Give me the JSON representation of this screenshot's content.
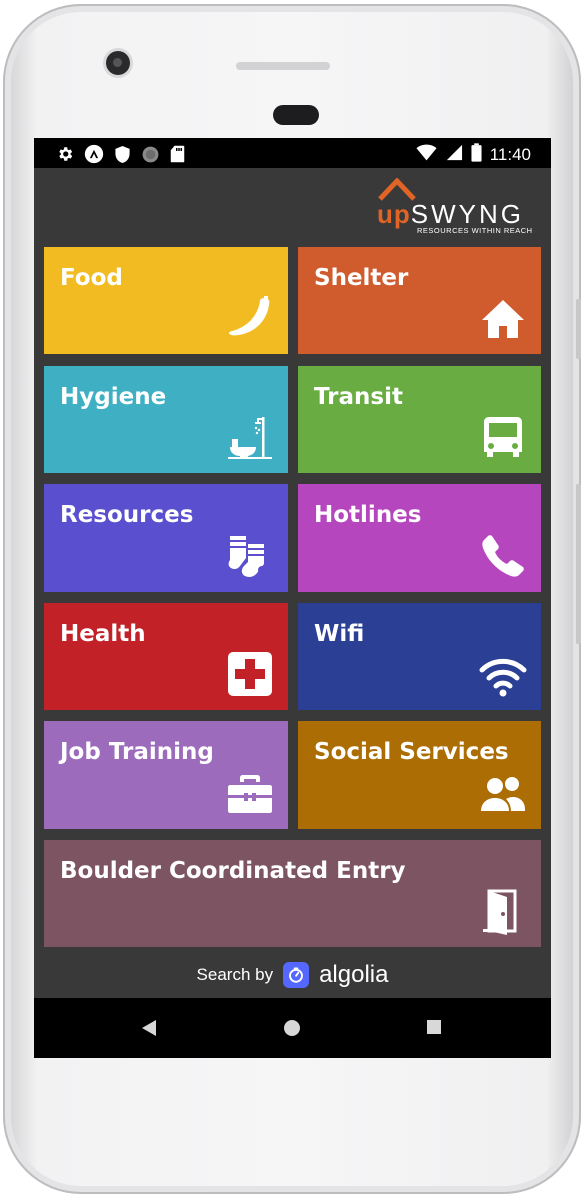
{
  "status_bar": {
    "time": "11:40"
  },
  "brand": {
    "up": "up",
    "rest": "SWYNG",
    "tagline": "RESOURCES WITHIN REACH",
    "accent": "#e06425"
  },
  "tiles": [
    {
      "id": "food",
      "label": "Food",
      "color": "#f2bb22",
      "icon": "banana-icon"
    },
    {
      "id": "shelter",
      "label": "Shelter",
      "color": "#d05b2d",
      "icon": "house-icon"
    },
    {
      "id": "hygiene",
      "label": "Hygiene",
      "color": "#3fb0c4",
      "icon": "toilet-shower-icon"
    },
    {
      "id": "transit",
      "label": "Transit",
      "color": "#68ac42",
      "icon": "bus-icon"
    },
    {
      "id": "resources",
      "label": "Resources",
      "color": "#5a4fcf",
      "icon": "socks-icon"
    },
    {
      "id": "hotlines",
      "label": "Hotlines",
      "color": "#b546be",
      "icon": "phone-icon"
    },
    {
      "id": "health",
      "label": "Health",
      "color": "#c12127",
      "icon": "medical-cross-icon"
    },
    {
      "id": "wifi",
      "label": "Wifi",
      "color": "#2b3f95",
      "icon": "wifi-icon"
    },
    {
      "id": "job_training",
      "label": "Job Training",
      "color": "#9c6bbb",
      "icon": "toolbox-icon"
    },
    {
      "id": "social_services",
      "label": "Social Services",
      "color": "#ac6d05",
      "icon": "people-icon"
    },
    {
      "id": "coordinated_entry",
      "label": "Boulder Coordinated Entry",
      "color": "#7c5462",
      "icon": "door-icon"
    }
  ],
  "footer": {
    "search_by": "Search by",
    "provider": "algolia",
    "provider_color": "#5468ff"
  }
}
